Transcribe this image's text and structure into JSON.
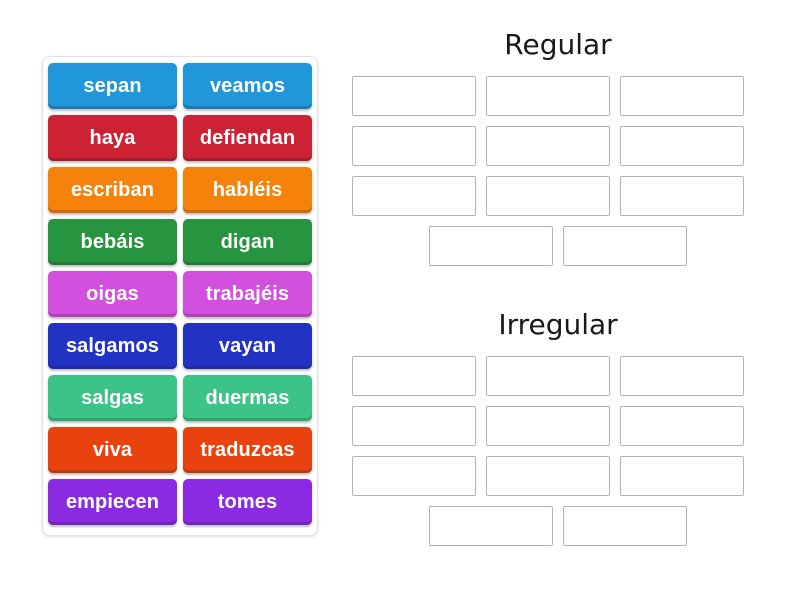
{
  "activity": {
    "type": "group-sort",
    "tile_text_color": "#ffffff"
  },
  "tiles": [
    {
      "label": "sepan",
      "color": "#2196d8"
    },
    {
      "label": "veamos",
      "color": "#2196d8"
    },
    {
      "label": "haya",
      "color": "#cc2233"
    },
    {
      "label": "defiendan",
      "color": "#cc2233"
    },
    {
      "label": "escriban",
      "color": "#f5820b"
    },
    {
      "label": "habléis",
      "color": "#f5820b"
    },
    {
      "label": "bebáis",
      "color": "#27953f"
    },
    {
      "label": "digan",
      "color": "#27953f"
    },
    {
      "label": "oigas",
      "color": "#d150dd"
    },
    {
      "label": "trabajéis",
      "color": "#d150dd"
    },
    {
      "label": "salgamos",
      "color": "#2233c4"
    },
    {
      "label": "vayan",
      "color": "#2233c4"
    },
    {
      "label": "salgas",
      "color": "#3cc486"
    },
    {
      "label": "duermas",
      "color": "#3cc486"
    },
    {
      "label": "viva",
      "color": "#e8430e"
    },
    {
      "label": "traduzcas",
      "color": "#e8430e"
    },
    {
      "label": "empiecen",
      "color": "#8a2be2"
    },
    {
      "label": "tomes",
      "color": "#8a2be2"
    }
  ],
  "groups": [
    {
      "title": "Regular",
      "slot_count": 11,
      "rows": [
        3,
        3,
        3,
        2
      ],
      "slots": [
        "",
        "",
        "",
        "",
        "",
        "",
        "",
        "",
        "",
        "",
        ""
      ]
    },
    {
      "title": "Irregular",
      "slot_count": 11,
      "rows": [
        3,
        3,
        3,
        2
      ],
      "slots": [
        "",
        "",
        "",
        "",
        "",
        "",
        "",
        "",
        "",
        "",
        ""
      ]
    }
  ]
}
